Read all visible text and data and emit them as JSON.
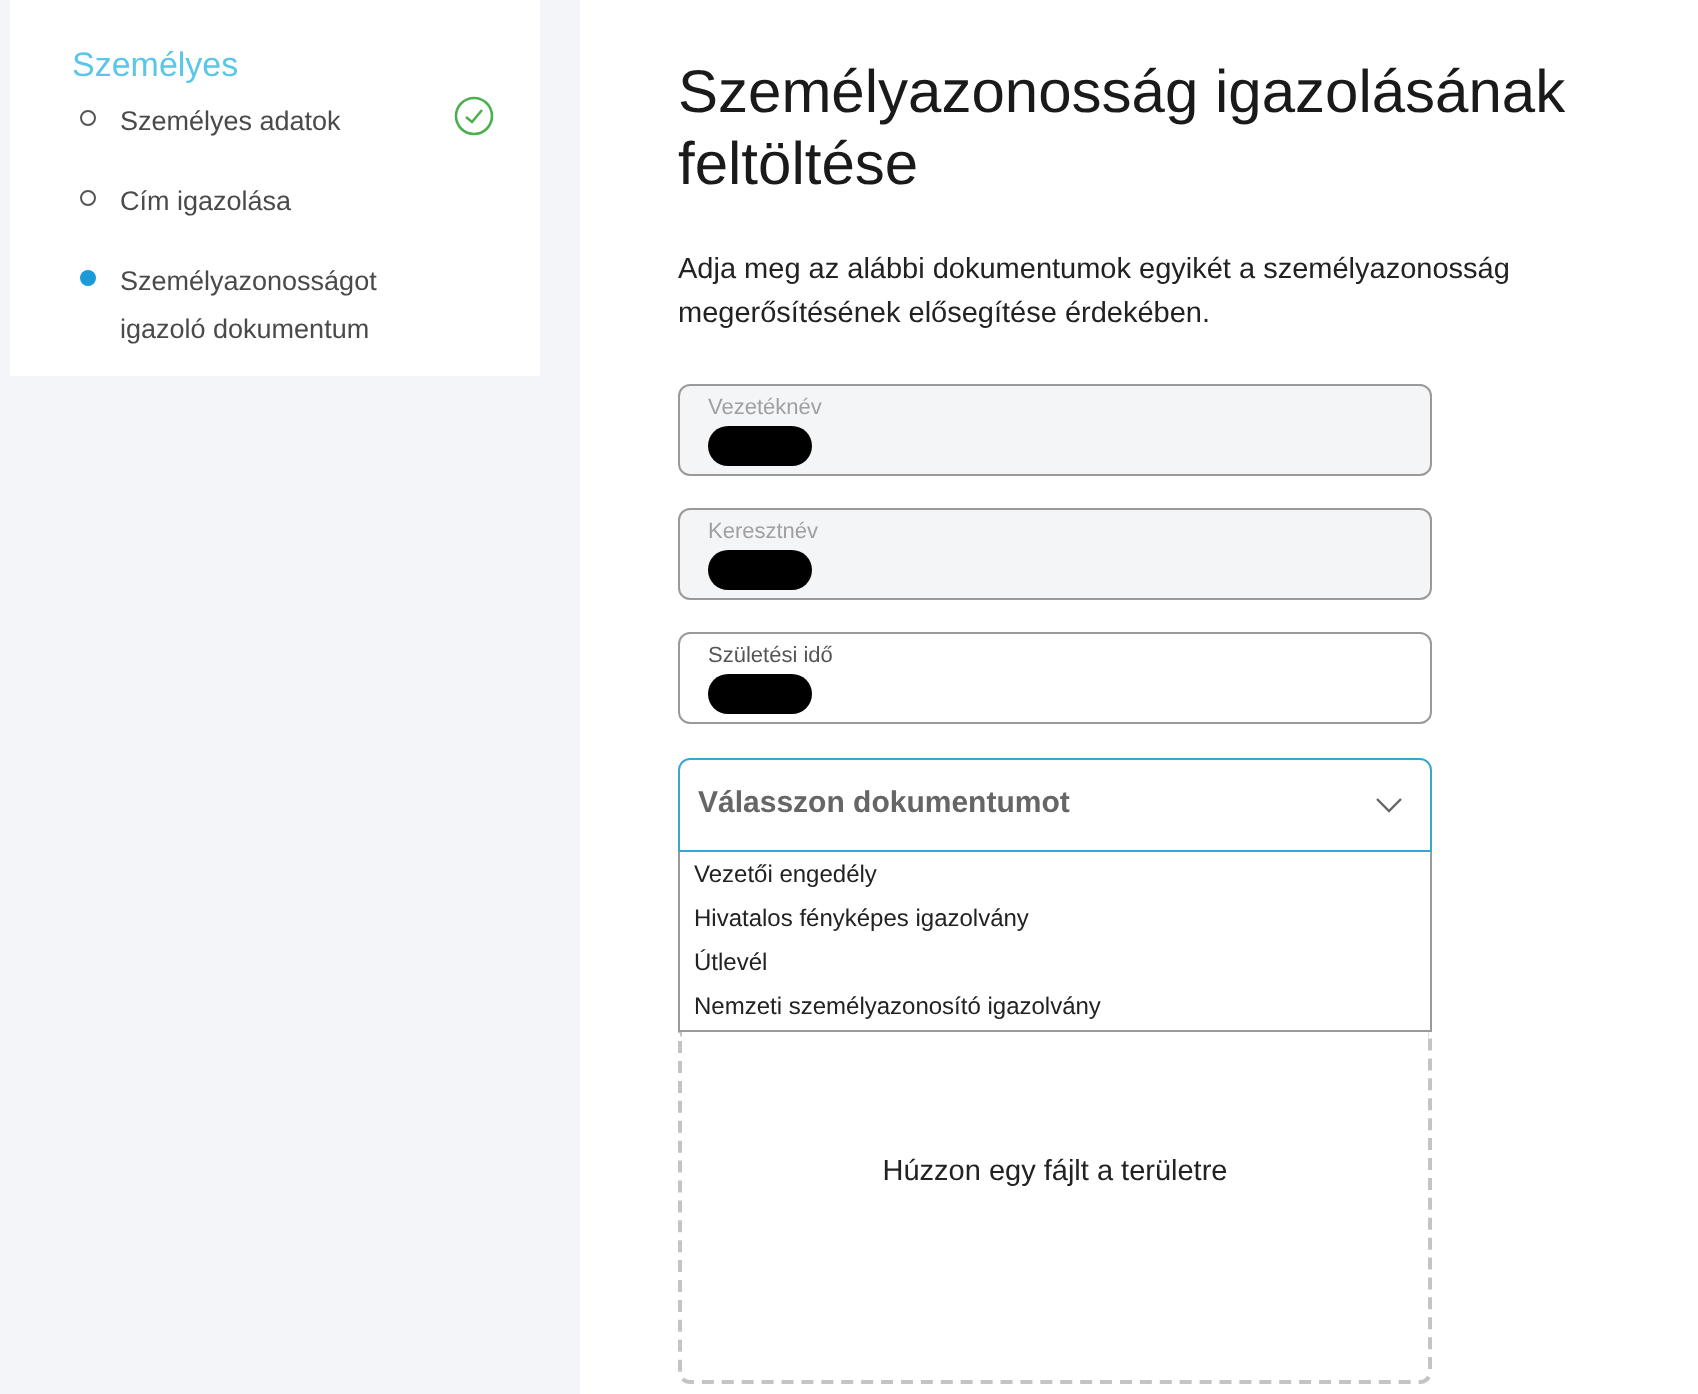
{
  "sidebar": {
    "heading": "Személyes",
    "steps": [
      {
        "label": "Személyes adatok",
        "selected": false,
        "completed": true
      },
      {
        "label": "Cím igazolása",
        "selected": false,
        "completed": false
      },
      {
        "label": "Személyazonosságot igazoló dokumentum",
        "selected": true,
        "completed": false
      }
    ]
  },
  "main": {
    "title": "Személyazonosság igazolásának feltöltése",
    "description": "Adja meg az alábbi dokumentumok egyikét a személyazonosság megerősítésének elősegítése érdekében.",
    "fields": [
      {
        "label": "Vezetéknév",
        "disabled": true,
        "redacted": true
      },
      {
        "label": "Keresztnév",
        "disabled": true,
        "redacted": true
      },
      {
        "label": "Születési idő",
        "disabled": false,
        "redacted": true
      }
    ],
    "document_select": {
      "placeholder": "Válasszon dokumentumot",
      "expanded": true,
      "options": [
        {
          "label": "Vezetői engedély",
          "selected": false
        },
        {
          "label": "Hivatalos fényképes igazolvány",
          "selected": false
        },
        {
          "label": "Útlevél",
          "selected": false
        },
        {
          "label": "Nemzeti személyazonosító igazolvány",
          "selected": false
        }
      ]
    },
    "dropzone": {
      "text": "Húzzon egy fájlt a területre"
    }
  }
}
